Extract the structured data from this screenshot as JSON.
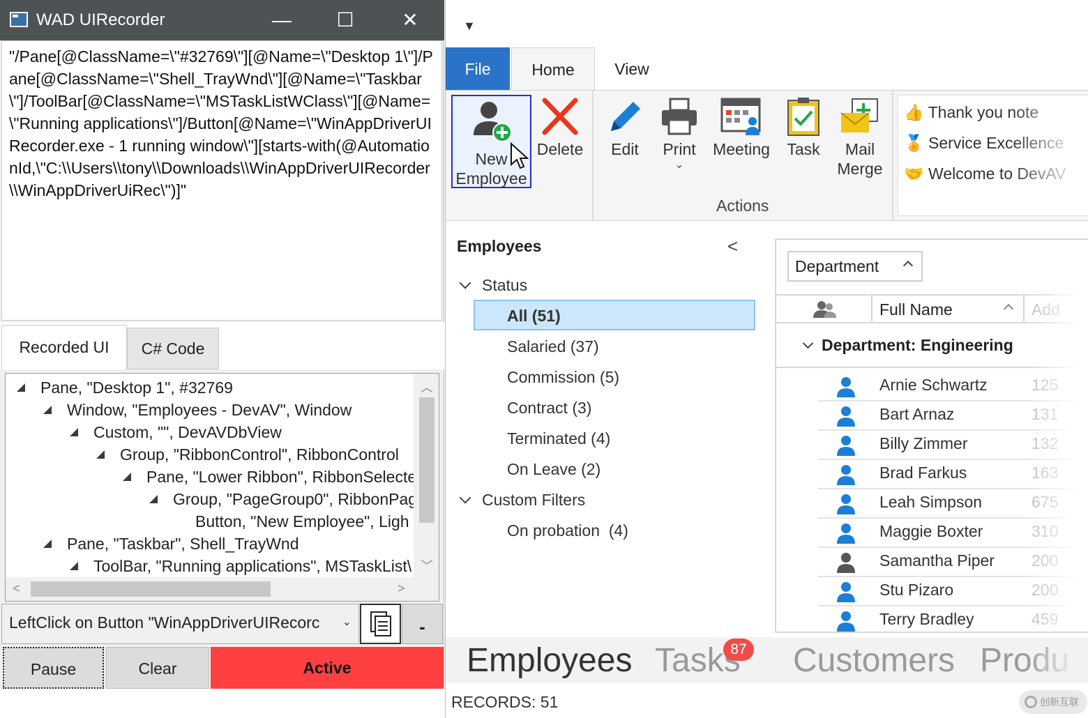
{
  "recorder": {
    "title": "WAD UIRecorder",
    "window_controls": {
      "minimize": "—",
      "maximize": "☐",
      "close": "✕"
    },
    "xpath_text": "\"/Pane[@ClassName=\\\"#32769\\\"][@Name=\\\"Desktop 1\\\"]/Pane[@ClassName=\\\"Shell_TrayWnd\\\"][@Name=\\\"Taskbar\\\"]/ToolBar[@ClassName=\\\"MSTaskListWClass\\\"][@Name=\\\"Running applications\\\"]/Button[@Name=\\\"WinAppDriverUIRecorder.exe - 1 running window\\\"][starts-with(@AutomationId,\\\"C:\\\\Users\\\\tony\\\\Downloads\\\\WinAppDriverUIRecorder\\\\WinAppDriverUiRec\\\")]\"",
    "tabs": [
      "Recorded UI",
      "C# Code"
    ],
    "tree": [
      {
        "text": "Pane, \"Desktop 1\", #32769",
        "expander": true
      },
      {
        "text": "Window, \"Employees - DevAV\", Window",
        "expander": true
      },
      {
        "text": "Custom, \"\", DevAVDbView",
        "expander": true
      },
      {
        "text": "Group, \"RibbonControl\", RibbonControl",
        "expander": true
      },
      {
        "text": "Pane, \"Lower Ribbon\", RibbonSelecte",
        "expander": true
      },
      {
        "text": "Group, \"PageGroup0\", RibbonPag",
        "expander": true
      },
      {
        "text": "Button, \"New Employee\", Ligh",
        "expander": false
      },
      {
        "text": "Pane, \"Taskbar\", Shell_TrayWnd",
        "expander": true
      },
      {
        "text": "ToolBar, \"Running applications\", MSTaskList\\",
        "expander": true
      }
    ],
    "status_text": "LeftClick on Button \"WinAppDriverUIRecorc",
    "buttons": {
      "pause": "Pause",
      "clear": "Clear",
      "active": "Active",
      "minimize": "-"
    }
  },
  "devav": {
    "ribbon_tabs": [
      "File",
      "Home",
      "View"
    ],
    "ribbon_buttons": {
      "new_employee": "New Employee",
      "delete": "Delete",
      "edit": "Edit",
      "print": "Print",
      "meeting": "Meeting",
      "task": "Task",
      "mail_merge": "Mail Merge"
    },
    "group_label": "Actions",
    "gallery": [
      "Thank you note",
      "Service Excellence",
      "Welcome to DevAV"
    ],
    "nav": {
      "title": "Employees",
      "status_group": "Status",
      "status_items": [
        "All (51)",
        "Salaried (37)",
        "Commission (5)",
        "Contract (3)",
        "Terminated (4)",
        "On Leave (2)"
      ],
      "custom_group": "Custom Filters",
      "custom_items": [
        "On probation  (4)"
      ]
    },
    "grid": {
      "group_by": "Department",
      "col_fullname": "Full Name",
      "col_address": "Add",
      "department_row": "Department: Engineering",
      "employees": [
        {
          "name": "Arnie Schwartz",
          "addr": "125"
        },
        {
          "name": "Bart Arnaz",
          "addr": "131"
        },
        {
          "name": "Billy Zimmer",
          "addr": "132"
        },
        {
          "name": "Brad Farkus",
          "addr": "163"
        },
        {
          "name": "Leah Simpson",
          "addr": "675"
        },
        {
          "name": "Maggie Boxter",
          "addr": "310"
        },
        {
          "name": "Samantha Piper",
          "addr": "200"
        },
        {
          "name": "Stu Pizaro",
          "addr": "200"
        },
        {
          "name": "Terry Bradley",
          "addr": "459"
        }
      ]
    },
    "bottom_nav": {
      "employees": "Employees",
      "tasks": "Tasks",
      "tasks_badge": "87",
      "customers": "Customers",
      "products": "Produ"
    },
    "records": "RECORDS: 51",
    "watermark": "创新互联"
  },
  "colors": {
    "accent_blue": "#2a73c8",
    "active_red": "#fe4040",
    "selection": "#cce6fb",
    "titlebar": "#4d5255"
  }
}
